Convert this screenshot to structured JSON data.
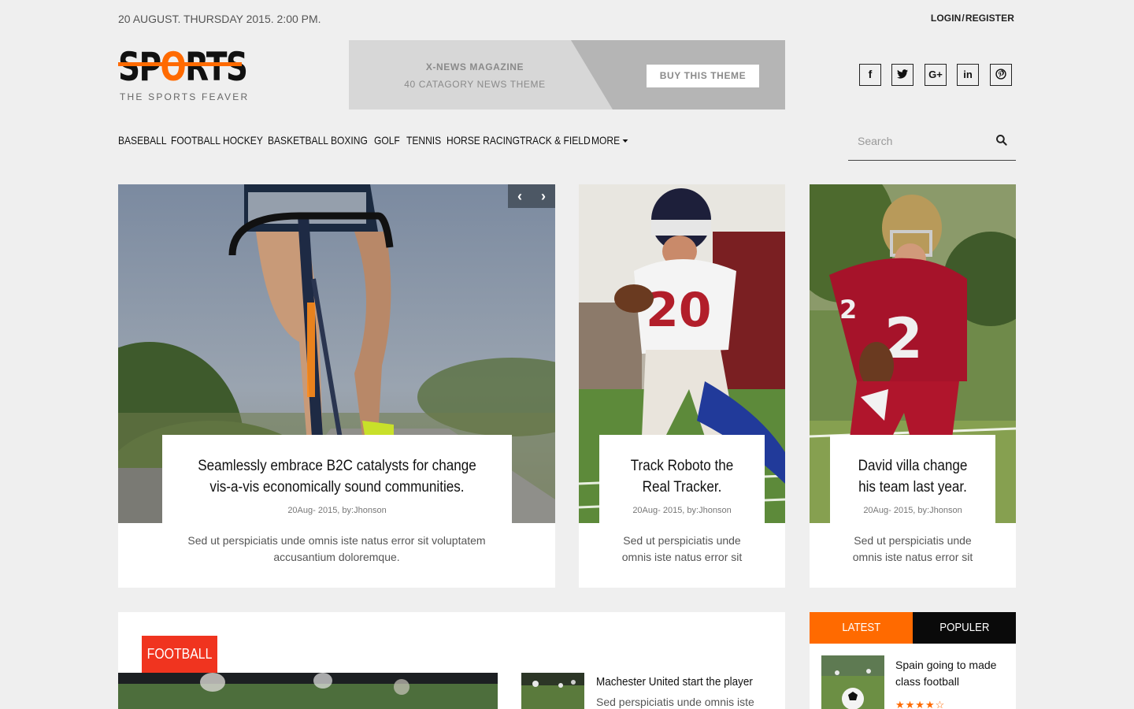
{
  "topbar": {
    "date": "20 AUGUST. THURSDAY 2015. 2:00 PM.",
    "login": "LOGIN",
    "separator": "/",
    "register": "REGISTER"
  },
  "logo": {
    "word_start": "SP",
    "word_o": "O",
    "word_end": "RTS",
    "tagline": "THE SPORTS FEAVER",
    "accent": "#ff6a00"
  },
  "banner": {
    "line1": "X-NEWS MAGAZINE",
    "line2": "40 CATAGORY NEWS THEME",
    "button": "BUY THIS THEME"
  },
  "social": [
    {
      "icon": "facebook-icon",
      "glyph": "f"
    },
    {
      "icon": "twitter-icon",
      "glyph": "t"
    },
    {
      "icon": "google-plus-icon",
      "glyph": "G+"
    },
    {
      "icon": "linkedin-icon",
      "glyph": "in"
    },
    {
      "icon": "pinterest-icon",
      "glyph": "p"
    }
  ],
  "nav": {
    "items": [
      "BASEBALL",
      "FOOTBALL",
      "HOCKEY",
      "BASKETBALL",
      "BOXING",
      "GOLF",
      "TENNIS",
      "HORSE RACING",
      "TRACK & FIELD",
      "MORE"
    ]
  },
  "search": {
    "placeholder": "Search"
  },
  "cards": [
    {
      "title": "Seamlessly embrace B2C catalysts for change vis-a-vis economically sound communities.",
      "meta": "20Aug- 2015, by:Jhonson",
      "excerpt": "Sed ut perspiciatis unde omnis iste natus error sit voluptatem accusantium doloremque."
    },
    {
      "title": "Track Roboto the Real Tracker.",
      "meta": "20Aug- 2015, by:Jhonson",
      "excerpt": "Sed ut perspiciatis unde omnis iste natus error sit"
    },
    {
      "title": "David villa change his team last year.",
      "meta": "20Aug- 2015, by:Jhonson",
      "excerpt": "Sed ut perspiciatis unde omnis iste natus error sit"
    }
  ],
  "slider": {
    "prev": "‹",
    "next": "›"
  },
  "football": {
    "tag": "FOOTBALL",
    "headline": "Machester United start the player",
    "excerpt": "Sed perspiciatis unde omnis iste"
  },
  "tabs": {
    "latest": "LATEST",
    "popular": "POPULER",
    "item_title": "Spain going to made class football",
    "rating": 4.5
  },
  "colors": {
    "accent": "#ff6a00",
    "football_tag": "#f0341f",
    "dark": "#0a0a0a"
  }
}
